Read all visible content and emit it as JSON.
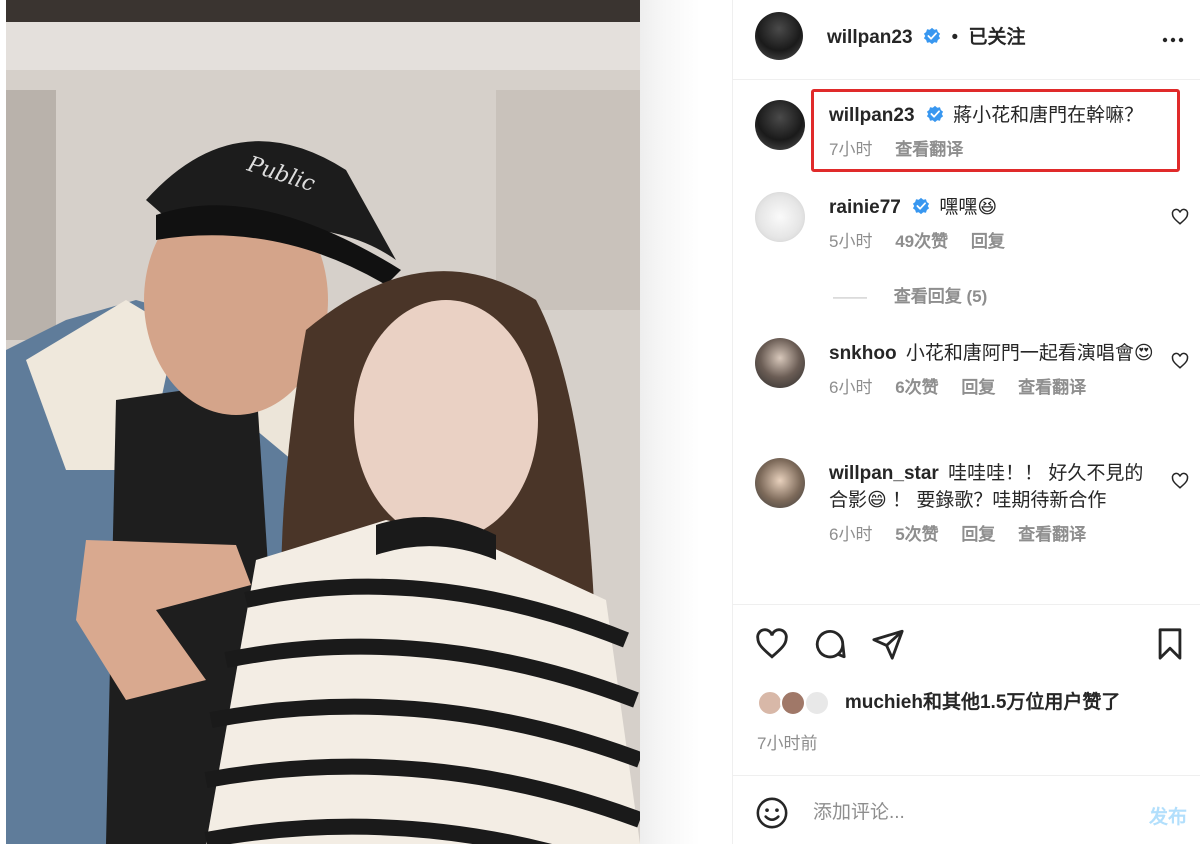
{
  "post": {
    "author": "willpan23",
    "follow_status": "已关注",
    "dot": "•"
  },
  "caption": {
    "username": "willpan23",
    "text": "蔣小花和唐門在幹嘛？",
    "time": "7小时",
    "translate": "查看翻译"
  },
  "comments": [
    {
      "username": "rainie77",
      "verified": true,
      "text": "嘿嘿😆",
      "time": "5小时",
      "likes": "49次赞",
      "reply": "回复"
    },
    {
      "username": "snkhoo",
      "verified": false,
      "text": "小花和唐阿門一起看演唱會😍",
      "time": "6小时",
      "likes": "6次赞",
      "reply": "回复",
      "translate": "查看翻译"
    },
    {
      "username": "willpan_star",
      "verified": false,
      "text": "哇哇哇！！ 好久不見的合影😄 ！ 要錄歌？哇期待新合作",
      "time": "6小时",
      "likes": "5次赞",
      "reply": "回复",
      "translate": "查看翻译"
    }
  ],
  "view_replies": {
    "line": "——",
    "label": "查看回复 (5)"
  },
  "likes_summary": {
    "liker": "muchieh",
    "text": "和其他1.5万位用户赞了"
  },
  "post_time": "7小时前",
  "comment_box": {
    "placeholder": "添加评论...",
    "post_label": "发布"
  },
  "colors": {
    "verified_blue": "#3897f0",
    "highlight_red": "#e02a2a",
    "post_button": "#b2dffc"
  },
  "icons": {
    "more": "more-icon",
    "like": "heart-icon",
    "comment": "comment-icon",
    "share": "send-icon",
    "save": "bookmark-icon",
    "emoji": "emoji-icon"
  }
}
